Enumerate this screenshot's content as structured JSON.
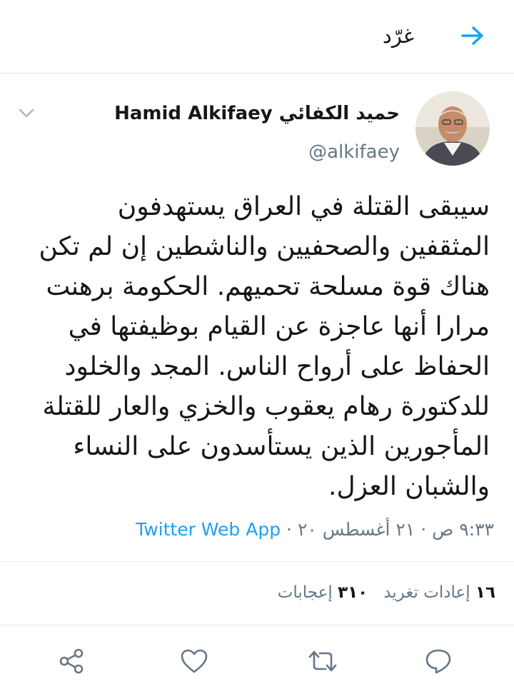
{
  "header": {
    "title": "غرّد",
    "back_icon": "arrow-right-icon"
  },
  "author": {
    "name": "حميد الكفائي Hamid Alkifaey",
    "handle": "@alkifaey"
  },
  "tweet": {
    "text": "سيبقى القتلة في العراق يستهدفون\nالمثقفين والصحفيين والناشطين إن لم تكن\nهناك قوة مسلحة تحميهم. الحكومة برهنت\nمرارا أنها عاجزة عن القيام بوظيفتها في\nالحفاظ على أرواح الناس. المجد والخلود\nللدكتورة رهام يعقوب والخزي والعار للقتلة\nالمأجورين الذين يستأسدون على النساء\nوالشبان العزل.",
    "timestamp": "٩:٣٣ ص · ٢١ أغسطس ٢٠ · ",
    "source": "Twitter Web App"
  },
  "stats": {
    "retweets_count": "١٦",
    "retweets_label": "إعادات تغريد",
    "likes_count": "٣١٠",
    "likes_label": "إعجابات"
  },
  "actions": [
    "reply-icon",
    "retweet-icon",
    "like-icon",
    "share-icon"
  ],
  "colors": {
    "accent": "#1da1f2",
    "text": "#14171a",
    "secondary": "#657786",
    "divider": "#e1e8ed"
  }
}
